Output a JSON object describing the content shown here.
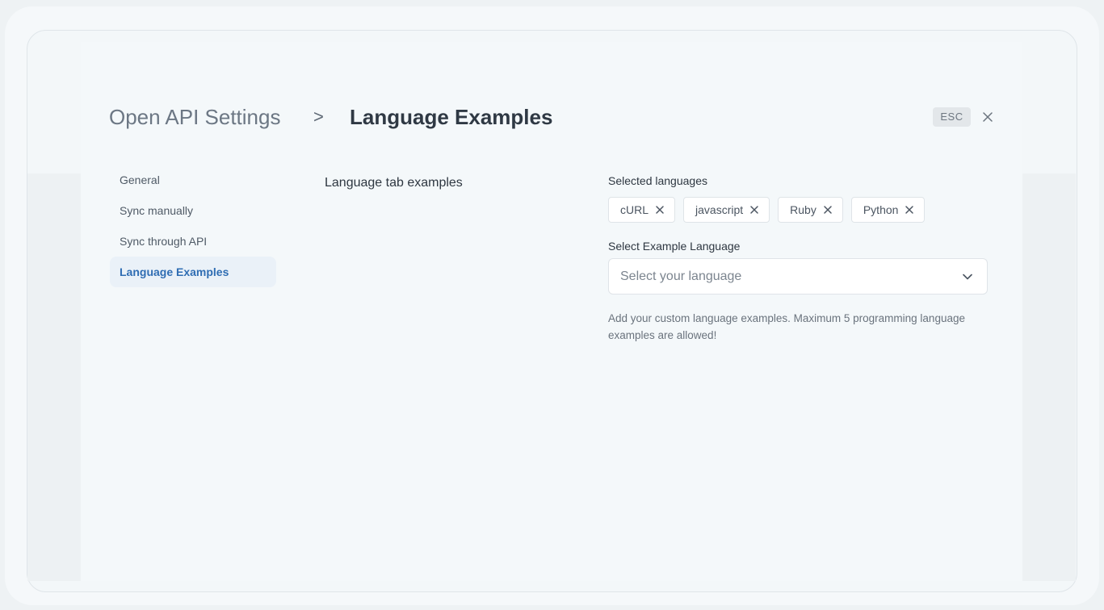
{
  "header": {
    "breadcrumb_root": "Open API Settings",
    "breadcrumb_separator": ">",
    "title": "Language Examples",
    "esc_label": "ESC",
    "close_icon": "close-icon"
  },
  "sidebar": {
    "items": [
      {
        "label": "General",
        "active": false
      },
      {
        "label": "Sync manually",
        "active": false
      },
      {
        "label": "Sync through API",
        "active": false
      },
      {
        "label": "Language Examples",
        "active": true
      }
    ]
  },
  "main": {
    "section_label": "Language tab examples",
    "selected_languages_label": "Selected languages",
    "selected_languages": [
      "cURL",
      "javascript",
      "Ruby",
      "Python"
    ],
    "select_label": "Select Example Language",
    "select_placeholder": "Select your language",
    "helper_text": "Add your custom language examples. Maximum 5 programming language examples are allowed!"
  },
  "colors": {
    "accent": "#2f6db3",
    "active_bg": "#eaf1f8",
    "page_bg": "#f4f8fa"
  }
}
